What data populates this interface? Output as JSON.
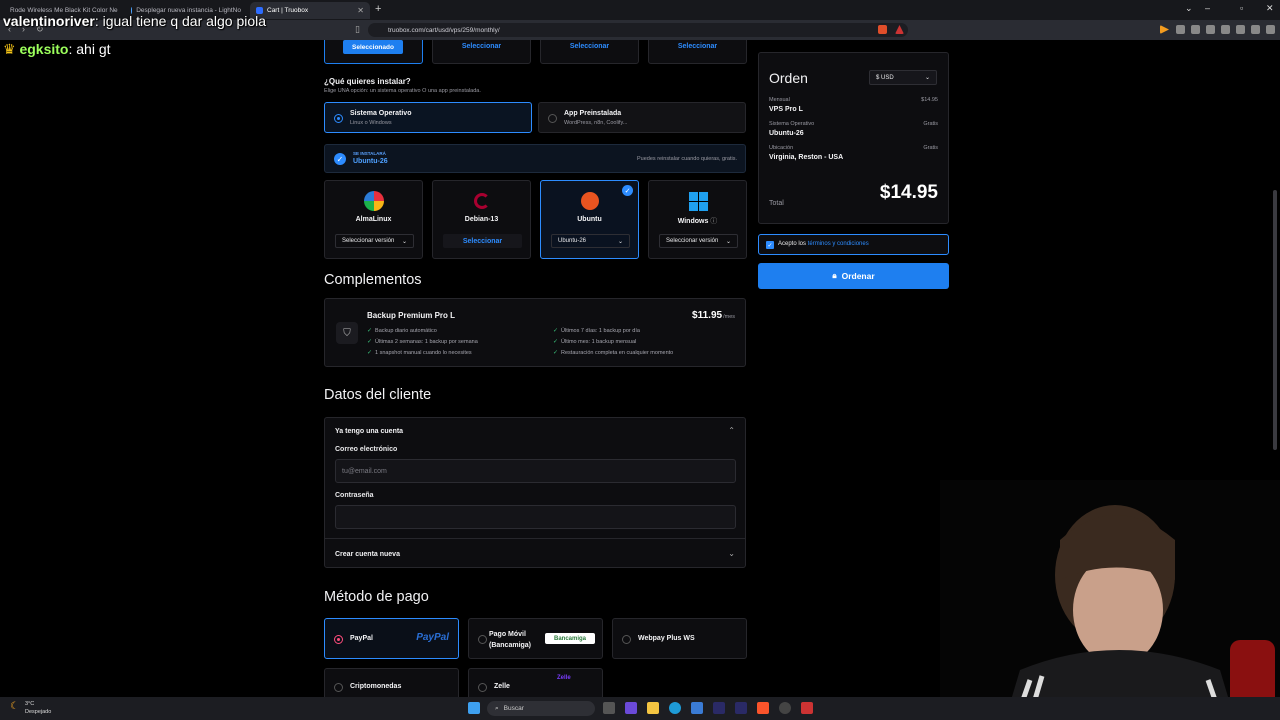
{
  "browser": {
    "tabs": [
      {
        "label": "Rode Wireless Me Black Kit Color Ne",
        "color": "#e0b040"
      },
      {
        "label": "Desplegar nueva instancia - LightNo",
        "color": "#4aa3ff"
      },
      {
        "label": "Cart | Truobox",
        "color": "#2d6cff"
      }
    ],
    "url": "truobox.com/cart/usd/vps/259/monthly/"
  },
  "chat": [
    {
      "user": "valentinoriver",
      "message": "igual tiene q dar algo piola",
      "user_color": "#ffffff"
    },
    {
      "user": "egksito",
      "message": "ahi gt",
      "user_color": "#9cff5c"
    }
  ],
  "top_row": {
    "selected_label": "Seleccionado",
    "select_labels": [
      "Seleccionar",
      "Seleccionar",
      "Seleccionar"
    ]
  },
  "install": {
    "title": "¿Qué quieres instalar?",
    "subtitle": "Elige UNA opción: un sistema operativo O una app preinstalada.",
    "options": [
      {
        "title": "Sistema Operativo",
        "desc": "Linux o Windows"
      },
      {
        "title": "App Preinstalada",
        "desc": "WordPress, n8n, Coolify..."
      }
    ],
    "banner_caption": "SE INSTALARÁ",
    "banner_value": "Ubuntu-26",
    "banner_note": "Puedes reinstalar cuando quieras, gratis."
  },
  "os": [
    {
      "name": "AlmaLinux",
      "action": "Seleccionar versión"
    },
    {
      "name": "Debian-13",
      "action": "Seleccionar"
    },
    {
      "name": "Ubuntu",
      "action": "Ubuntu-26"
    },
    {
      "name": "Windows",
      "action": "Seleccionar versión"
    }
  ],
  "addons": {
    "heading": "Complementos",
    "name": "Backup Premium Pro L",
    "price": "$11.95",
    "period": "/mes",
    "features_left": [
      "Backup diario automático",
      "Últimas 2 semanas: 1 backup por semana",
      "1 snapshot manual cuando lo necesites"
    ],
    "features_right": [
      "Últimos 7 días: 1 backup por día",
      "Último mes: 1 backup mensual",
      "Restauración completa en cualquier momento"
    ]
  },
  "client": {
    "heading": "Datos del cliente",
    "have_account": "Ya tengo una cuenta",
    "email_label": "Correo electrónico",
    "email_placeholder": "tu@email.com",
    "password_label": "Contraseña",
    "create_account": "Crear cuenta nueva"
  },
  "payment": {
    "heading": "Método de pago",
    "methods": [
      "PayPal",
      "Pago Móvil (Bancamiga)",
      "Webpay Plus WS",
      "Criptomonedas",
      "Zelle"
    ],
    "paypal_logo": "PayPal",
    "bancamiga_logo": "Bancamiga",
    "zelle_logo": "Zelle"
  },
  "order": {
    "title": "Orden",
    "currency": "$ USD",
    "rows": [
      {
        "label": "Mensual",
        "value": "VPS Pro L",
        "price": "$14.95"
      },
      {
        "label": "Sistema Operativo",
        "value": "Ubuntu-26",
        "price": "Gratis"
      },
      {
        "label": "Ubicación",
        "value": "Virginia, Reston - USA",
        "price": "Gratis"
      }
    ],
    "total_label": "Total",
    "total": "$14.95",
    "terms_prefix": "Acepto los",
    "terms_link": "términos y condiciones",
    "button": "Ordenar"
  },
  "taskbar": {
    "weather_temp": "3°C",
    "weather_desc": "Despejado",
    "search": "Buscar"
  },
  "colors": {
    "accent": "#1e7ff0",
    "page_bg": "#000000",
    "card_bg": "#0d0d10"
  }
}
